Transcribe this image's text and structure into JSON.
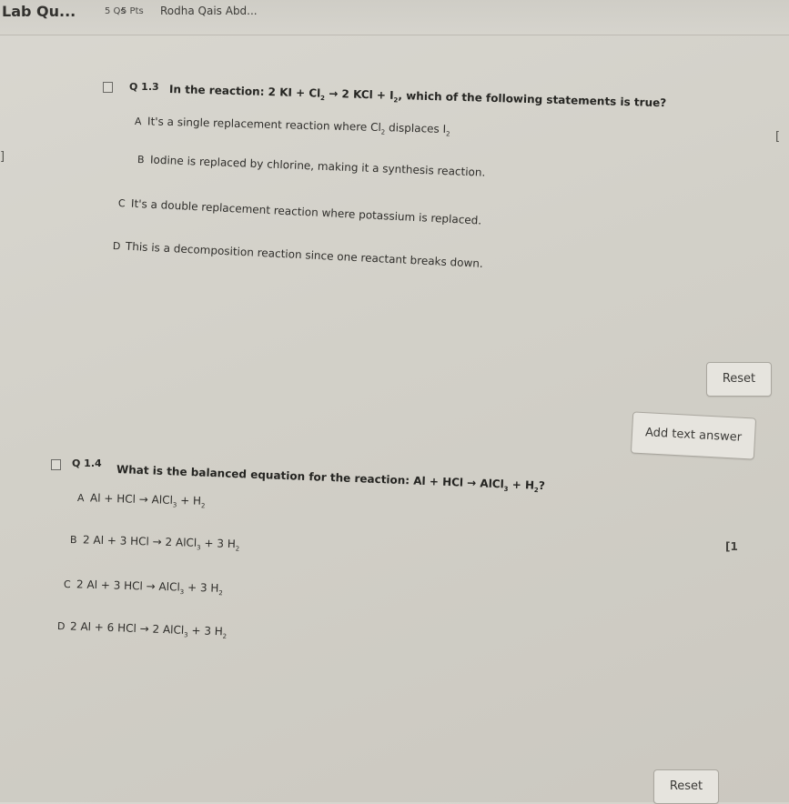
{
  "header": {
    "title": "Lab Qu...",
    "question_count": "5 Qs",
    "points": "5 Pts",
    "user": "Rodha Qais Abd..."
  },
  "q13": {
    "number": "Q 1.3",
    "prompt_prefix": "In the reaction: 2 KI + Cl",
    "sub1": "2",
    "mid1": " → 2 KCl + I",
    "sub2": "2",
    "suffix": ", which of the following statements is true?",
    "options": [
      {
        "letter": "A",
        "text_a": "It's a single replacement reaction where Cl",
        "sub": "2",
        "text_b": " displaces I",
        "sub2": "2"
      },
      {
        "letter": "B",
        "text": "Iodine is replaced by chlorine, making it a synthesis reaction."
      },
      {
        "letter": "C",
        "text": "It's a double replacement reaction where potassium is replaced."
      },
      {
        "letter": "D",
        "text": "This is a decomposition reaction since one reactant breaks down."
      }
    ],
    "reset_label": "Reset",
    "add_text_label": "Add text answer"
  },
  "q14": {
    "number": "Q 1.4",
    "prompt_prefix": "What is the balanced equation for the reaction: Al + HCl → AlCl",
    "sub1": "3",
    "mid1": " + H",
    "sub2": "2",
    "suffix": "?",
    "options": [
      {
        "letter": "A",
        "pre": "Al + HCl → AlCl",
        "s1": "3",
        "mid": " + H",
        "s2": "2"
      },
      {
        "letter": "B",
        "pre": "2 Al + 3 HCl → 2 AlCl",
        "s1": "3",
        "mid": " + 3 H",
        "s2": "2"
      },
      {
        "letter": "C",
        "pre": "2 Al + 3 HCl → AlCl",
        "s1": "3",
        "mid": " + 3 H",
        "s2": "2"
      },
      {
        "letter": "D",
        "pre": "2 Al + 6 HCl → 2 AlCl",
        "s1": "3",
        "mid": " + 3 H",
        "s2": "2"
      }
    ],
    "side_marker": "[1",
    "reset_label": "Reset"
  },
  "edge_marks": {
    "right_bracket": "[",
    "left_bracket": "]"
  }
}
